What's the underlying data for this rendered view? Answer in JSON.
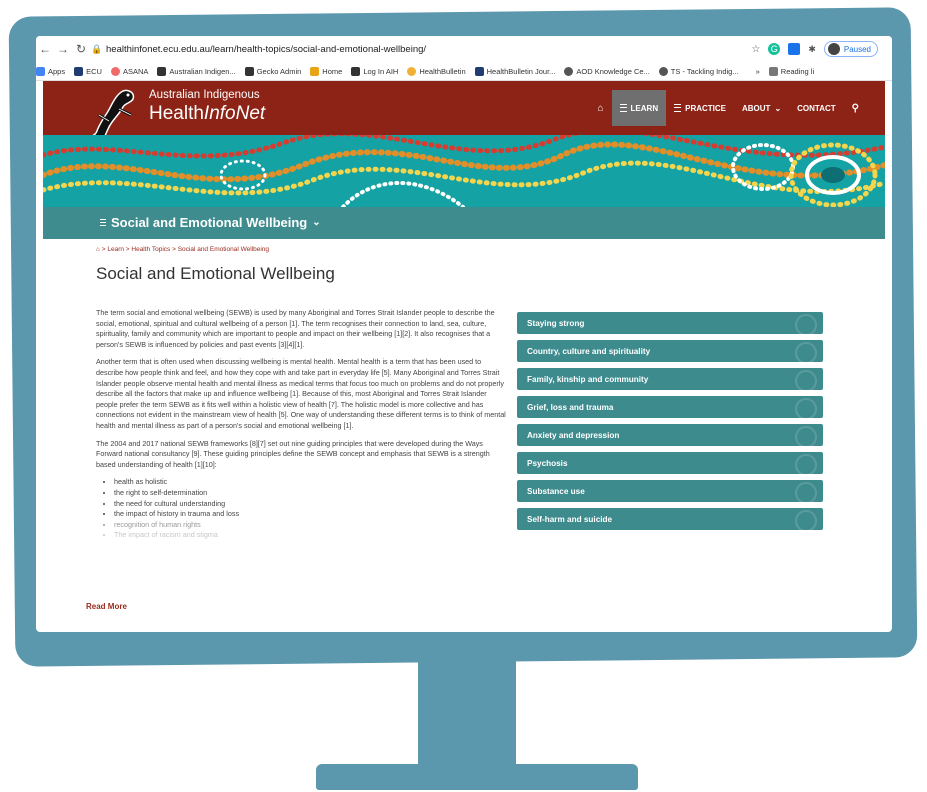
{
  "browser": {
    "url": "healthinfonet.ecu.edu.au/learn/health-topics/social-and-emotional-wellbeing/",
    "profile_status": "Paused",
    "bookmarks": [
      "Apps",
      "ECU",
      "ASANA",
      "Australian Indigen...",
      "Gecko Admin",
      "Home",
      "Log In AIH",
      "HealthBulletin",
      "HealthBulletin Jour...",
      "AOD Knowledge Ce...",
      "TS - Tackling Indig...",
      "Reading li"
    ],
    "more_bookmarks": "»"
  },
  "site": {
    "logo_line1": "Australian Indigenous",
    "logo_line2_a": "Health",
    "logo_line2_b": "InfoNet",
    "nav": {
      "home_icon": "home-icon",
      "learn": "LEARN",
      "practice": "PRACTICE",
      "about": "ABOUT",
      "contact": "CONTACT",
      "search_icon": "search-icon"
    },
    "section_title": "Social and Emotional Wellbeing",
    "breadcrumb": "> Learn > Health Topics > Social and Emotional Wellbeing",
    "page_title": "Social and Emotional Wellbeing"
  },
  "article": {
    "p1": "The term social and emotional wellbeing (SEWB) is used by many Aboriginal and Torres Strait Islander people to describe the social, emotional, spiritual and cultural wellbeing of a person [1]. The term recognises their connection to land, sea, culture, spirituality, family and community which are important to people and impact on their wellbeing [1][2]. It also recognises that a person's SEWB is influenced by policies and past events [3][4][1].",
    "p2": "Another term that is often used when discussing wellbeing is mental health. Mental health is a term that has been used to describe how people think and feel, and how they cope with and take part in everyday life [5]. Many Aboriginal and Torres Strait Islander people observe mental health and mental illness as medical terms that focus too much on problems and do not properly describe all the factors that make up and influence wellbeing [1]. Because of this, most Aboriginal and Torres Strait Islander people prefer the term SEWB as it fits well within a holistic view of health [7]. The holistic model is more collective and has connections not evident in the mainstream view of health [5]. One way of understanding these different terms is to think of mental health and mental illness as part of a person's social and emotional wellbeing [1].",
    "p3": "The 2004 and 2017 national SEWB frameworks [8][7] set out nine guiding principles that were developed during the Ways Forward national consultancy [9]. These guiding principles define the SEWB concept and emphasis that SEWB is a strength based understanding of health [1][10]:",
    "bullets": [
      "health as holistic",
      "the right to self-determination",
      "the need for cultural understanding",
      "the impact of history in trauma and loss",
      "recognition of human rights",
      "The impact of racism and stigma"
    ],
    "read_more": "Read More"
  },
  "topics": [
    "Staying strong",
    "Country, culture and spirituality",
    "Family, kinship and community",
    "Grief, loss and trauma",
    "Anxiety and depression",
    "Psychosis",
    "Substance use",
    "Self-harm and suicide"
  ],
  "colors": {
    "frame": "#5b97ad",
    "header": "#8c2316",
    "teal": "#3f8c8f",
    "link": "#9a2b1d"
  }
}
